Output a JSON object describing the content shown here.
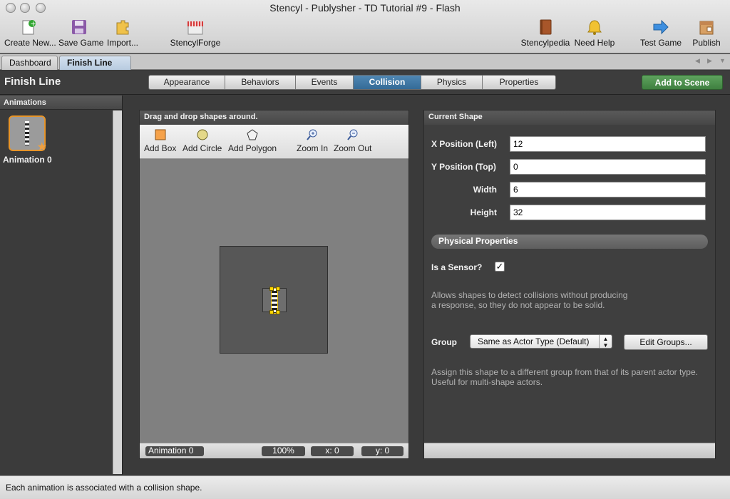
{
  "window": {
    "title": "Stencyl - Publysher - TD Tutorial #9 - Flash"
  },
  "toolbar": {
    "create_new": "Create New...",
    "save_game": "Save Game",
    "import": "Import...",
    "stencylforge": "StencylForge",
    "stencylpedia": "Stencylpedia",
    "need_help": "Need Help",
    "test_game": "Test Game",
    "publish": "Publish"
  },
  "tabs": [
    {
      "label": "Dashboard",
      "active": false
    },
    {
      "label": "Finish Line",
      "active": true,
      "close": "×"
    }
  ],
  "header": {
    "title": "Finish Line",
    "segments": [
      "Appearance",
      "Behaviors",
      "Events",
      "Collision",
      "Physics",
      "Properties"
    ],
    "active_segment": "Collision",
    "add_to_scene": "Add to Scene"
  },
  "animations": {
    "heading": "Animations",
    "items": [
      {
        "label": "Animation 0"
      }
    ]
  },
  "editor": {
    "heading": "Drag and drop shapes around.",
    "tools": [
      "Add Box",
      "Add Circle",
      "Add Polygon",
      "Zoom In",
      "Zoom Out"
    ],
    "status": {
      "animation": "Animation 0",
      "zoom": "100%",
      "x": "x:  0",
      "y": "y:  0"
    }
  },
  "shape": {
    "heading": "Current Shape",
    "fields": [
      {
        "label": "X Position (Left)",
        "value": "12"
      },
      {
        "label": "Y Position (Top)",
        "value": "0"
      },
      {
        "label": "Width",
        "value": "6"
      },
      {
        "label": "Height",
        "value": "32"
      }
    ],
    "physical_heading": "Physical Properties",
    "sensor_label": "Is a Sensor?",
    "sensor_checked": true,
    "sensor_help_1": "Allows shapes to detect collisions without producing",
    "sensor_help_2": "a response, so they do not appear to be solid.",
    "group_label": "Group",
    "group_value": "Same as Actor Type (Default)",
    "edit_groups": "Edit Groups...",
    "group_help_1": "Assign this shape to a different group from that of its parent actor type.",
    "group_help_2": "Useful for multi-shape actors."
  },
  "statusbar": {
    "text": "Each animation is associated with a collision shape."
  },
  "colors": {
    "accent": "#3f6f99",
    "add_to_scene": "#4a8f4a",
    "highlight": "#e7952a"
  }
}
